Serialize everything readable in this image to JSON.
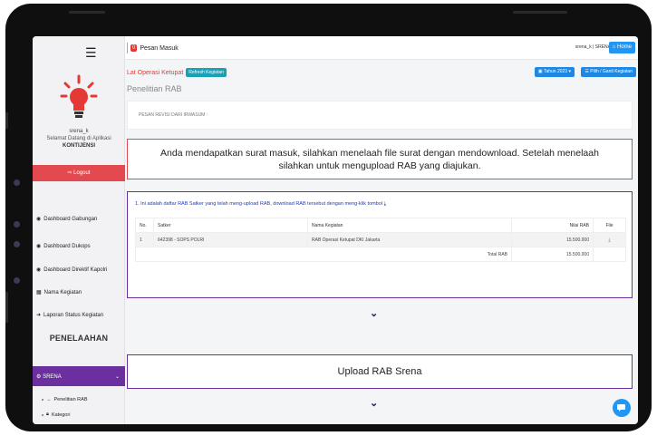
{
  "topbar": {
    "pesan_label": "Pesan Masuk",
    "pesan_badge": "0",
    "user_info": "srena_k | SRENA",
    "home_label": "Home"
  },
  "sidebar": {
    "user_name": "srena_k",
    "welcome": "Selamat Datang di Aplikasi",
    "role": "KONTIJENSI",
    "logout_label": "Logout",
    "items": [
      {
        "label": "Dashboard Gabungan"
      },
      {
        "label": "Dashboard Dukops"
      },
      {
        "label": "Dashboard Direktif Kapolri"
      },
      {
        "label": "Nama Kegiatan"
      },
      {
        "label": "Laporan Status Kegiatan"
      }
    ],
    "section_title": "PENELAAHAN",
    "srena_label": "SRENA",
    "sub_items": [
      {
        "label": "Penelitian RAB"
      },
      {
        "label": "Kategori"
      }
    ]
  },
  "content": {
    "op_title": "Lat Operasi Ketupat",
    "refresh_label": "Refresh Kegiatan",
    "tahun_label": "Tahun 2023",
    "ganti_label": "Pilih / Ganti Kegiatan",
    "page_title": "Penelitian RAB",
    "revisi_label": "PESAN REVISI DARI IRWASUM :",
    "alert_text": "Anda mendapatkan surat masuk, silahkan menelaah file surat dengan mendownload. Setelah menelaah silahkan untuk mengupload RAB yang diajukan.",
    "list_head": "1. Ini adalah daftar RAB Satker yang telah meng-upload RAB, download RAB tersebut dengan meng-klik tombol",
    "table": {
      "headers": [
        "No.",
        "Satker",
        "Nama Kegiatan",
        "Nilai RAB",
        "File"
      ],
      "rows": [
        {
          "no": "1",
          "satker": "642398 - SOPS POLRI",
          "kegiatan": "RAB Operasi Ketupat DKI Jakarta",
          "nilai": "15.500.000"
        }
      ],
      "total_label": "Total RAB",
      "total_value": "15.500.000"
    },
    "upload_label": "Upload RAB Srena"
  },
  "colors": {
    "accent_purple": "#6b2fa0",
    "alert_red": "#e04a4f",
    "primary_blue": "#2196f3"
  }
}
